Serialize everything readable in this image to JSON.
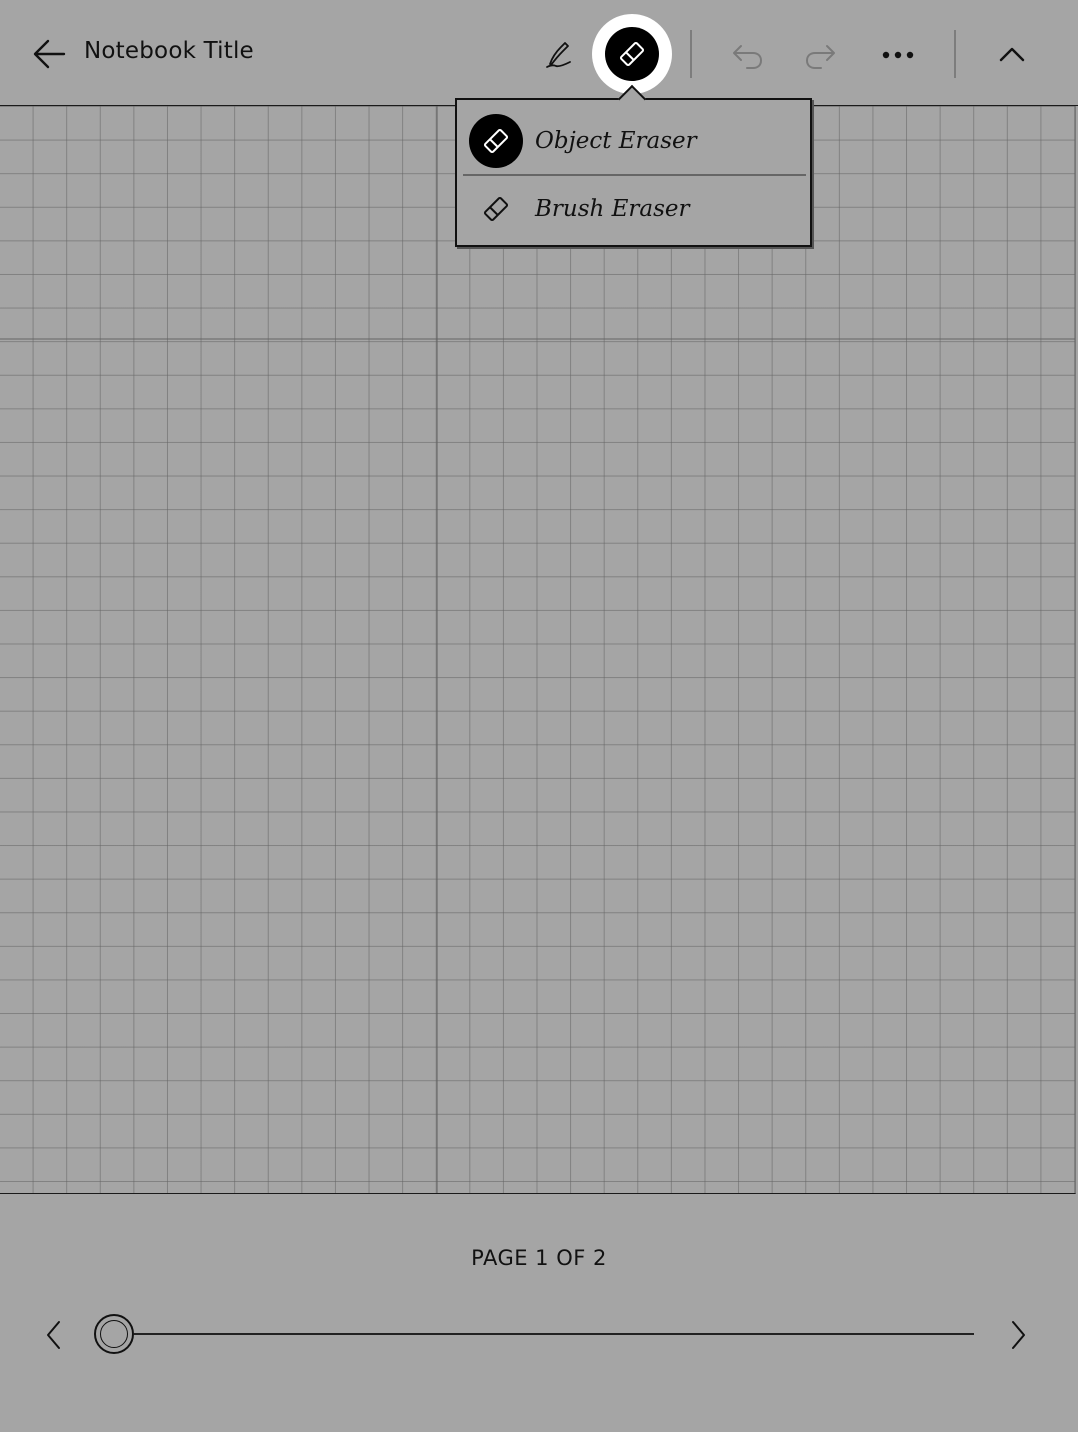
{
  "toolbar": {
    "title": "Notebook Title",
    "back_icon": "arrow-left-icon",
    "pen_icon": "pen-icon",
    "eraser_icon": "eraser-icon",
    "undo_icon": "undo-icon",
    "redo_icon": "redo-icon",
    "more_icon": "more-horizontal-icon",
    "collapse_icon": "chevron-up-icon"
  },
  "eraser_menu": {
    "items": [
      {
        "label": "Object Eraser",
        "icon": "eraser-icon",
        "selected": true
      },
      {
        "label": "Brush Eraser",
        "icon": "eraser-icon",
        "selected": false
      }
    ]
  },
  "footer": {
    "page_indicator": "PAGE 1 OF 2",
    "current_page": 1,
    "total_pages": 2,
    "prev_icon": "chevron-left-icon",
    "next_icon": "chevron-right-icon"
  },
  "colors": {
    "background": "#a5a5a5",
    "ink": "#111111",
    "selected_tool_bg": "#000000",
    "selected_tool_ring": "#ffffff"
  }
}
